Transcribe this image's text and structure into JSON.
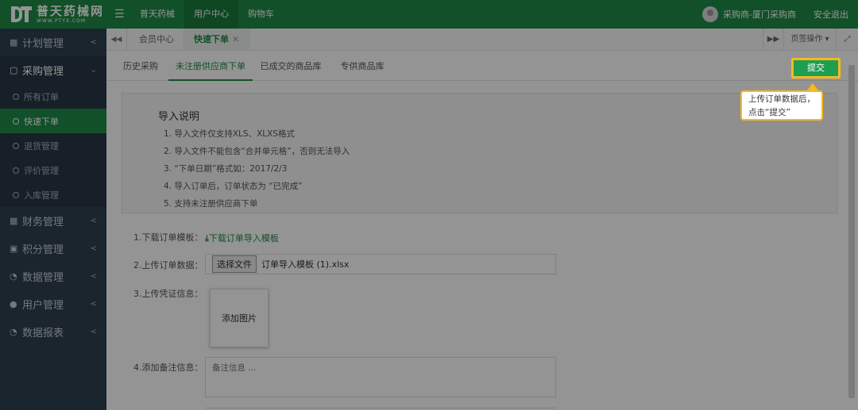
{
  "header": {
    "logo_title": "普天药械网",
    "logo_sub": "WWW.PTYX.COM",
    "nav": [
      "普天药械",
      "用户中心",
      "购物车"
    ],
    "active_nav": 1,
    "user_name": "采购商-厦门采购商",
    "logout": "安全退出"
  },
  "sidebar": {
    "groups": [
      {
        "label": "计划管理",
        "icon": "bar-chart-icon"
      },
      {
        "label": "采购管理",
        "icon": "bag-icon",
        "open": true
      },
      {
        "label": "财务管理",
        "icon": "calculator-icon"
      },
      {
        "label": "积分管理",
        "icon": "database-icon"
      },
      {
        "label": "数据管理",
        "icon": "pie-chart-icon"
      },
      {
        "label": "用户管理",
        "icon": "user-icon"
      },
      {
        "label": "数据报表",
        "icon": "pie-chart-icon"
      }
    ],
    "sub_items": [
      "所有订单",
      "快速下单",
      "退货管理",
      "评价管理",
      "入库管理"
    ],
    "active_sub": 1
  },
  "tabbar": {
    "tabs": [
      "会员中心",
      "快速下单"
    ],
    "active_tab": 1,
    "page_ops": "页签操作"
  },
  "content": {
    "tabs": [
      "历史采购",
      "未注册供应商下单",
      "已成交的商品库",
      "专供商品库"
    ],
    "active_tab": 1,
    "submit_label": "提交",
    "callout_line1": "上传订单数据后，",
    "callout_line2": "点击“提交”",
    "notice_title": "导入说明",
    "notice_items": [
      "1. 导入文件仅支持XLS、XLXS格式",
      "2. 导入文件不能包含“合并单元格”，否则无法导入",
      "3. “下单日期”格式如：2017/2/3",
      "4. 导入订单后，订单状态为 “已完成”",
      "5. 支持未注册供应商下单"
    ],
    "form": {
      "download_label": "1.下载订单模板：",
      "download_link": "下载订单导入模板",
      "upload_label": "2.上传订单数据：",
      "choose_file": "选择文件",
      "file_name": "订单导入模板 (1).xlsx",
      "proof_label": "3.上传凭证信息：",
      "add_image": "添加图片",
      "note_label": "4.添加备注信息：",
      "note_placeholder": "备注信息 ..."
    }
  }
}
